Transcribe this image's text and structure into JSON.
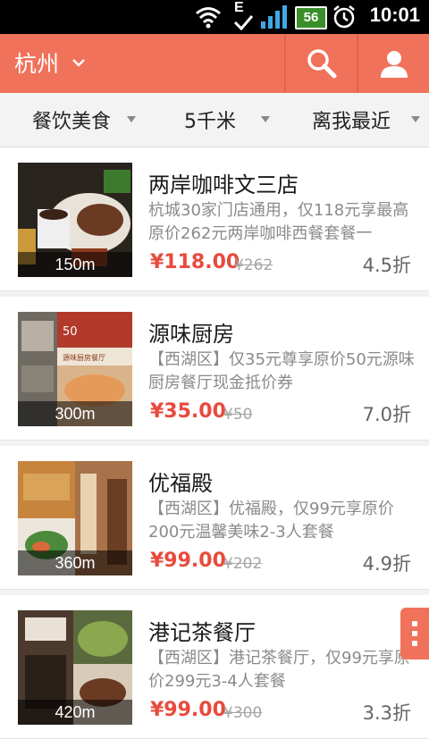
{
  "status_bar": {
    "time": "10:01",
    "network_label": "E",
    "battery": "56",
    "icons": [
      "wifi-icon",
      "signal-icon",
      "battery-icon",
      "alarm-icon"
    ]
  },
  "header": {
    "city": "杭州",
    "search_icon": "search-icon",
    "user_icon": "user-icon",
    "bg_color": "#f0725a"
  },
  "filters": {
    "category": "餐饮美食",
    "distance": "5千米",
    "sort": "离我最近"
  },
  "deals": [
    {
      "title": "两岸咖啡文三店",
      "description": "杭城30家门店通用，仅118元享最高原价262元两岸咖啡西餐套餐一",
      "price": "¥118.00",
      "original_price": "¥262",
      "discount": "4.5折",
      "distance": "150m"
    },
    {
      "title": "源味厨房",
      "description": "【西湖区】仅35元尊享原价50元源味厨房餐厅现金抵价券",
      "price": "¥35.00",
      "original_price": "¥50",
      "discount": "7.0折",
      "distance": "300m"
    },
    {
      "title": "优福殿",
      "description": "【西湖区】优福殿，仅99元享原价200元温馨美味2-3人套餐",
      "price": "¥99.00",
      "original_price": "¥202",
      "discount": "4.9折",
      "distance": "360m"
    },
    {
      "title": "港记茶餐厅",
      "description": "【西湖区】港记茶餐厅，仅99元享原价299元3-4人套餐",
      "price": "¥99.00",
      "original_price": "¥300",
      "discount": "3.3折",
      "distance": "420m"
    }
  ],
  "colors": {
    "accent": "#f0725a",
    "price": "#e84a3c"
  }
}
